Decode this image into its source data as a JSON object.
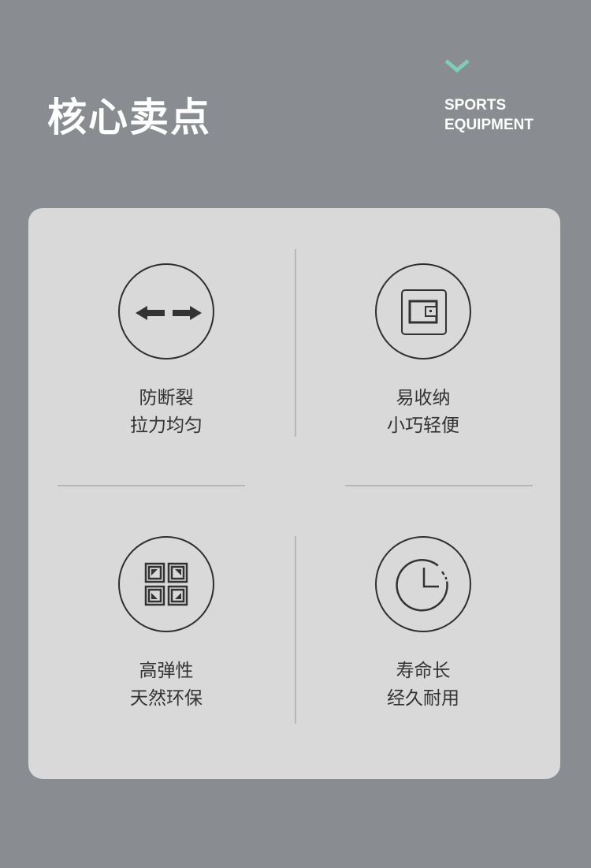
{
  "header": {
    "title": "核心卖点",
    "subtitle_line1": "SPORTS",
    "subtitle_line2": "EQUIPMENT",
    "accent_color": "#7ecdb4"
  },
  "features": [
    {
      "icon": "double-arrow-icon",
      "line1": "防断裂",
      "line2": "拉力均匀"
    },
    {
      "icon": "wallet-icon",
      "line1": "易收纳",
      "line2": "小巧轻便"
    },
    {
      "icon": "grid-squares-icon",
      "line1": "高弹性",
      "line2": "天然环保"
    },
    {
      "icon": "clock-icon",
      "line1": "寿命长",
      "line2": "经久耐用"
    }
  ]
}
